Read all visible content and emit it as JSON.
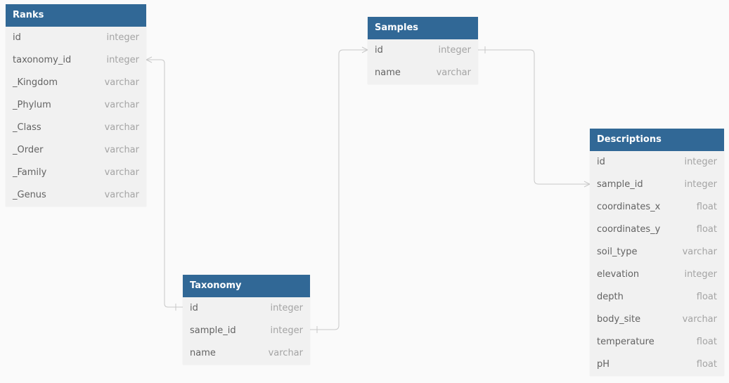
{
  "tables": {
    "ranks": {
      "title": "Ranks",
      "columns": [
        {
          "name": "id",
          "type": "integer"
        },
        {
          "name": "taxonomy_id",
          "type": "integer"
        },
        {
          "name": "_Kingdom",
          "type": "varchar"
        },
        {
          "name": "_Phylum",
          "type": "varchar"
        },
        {
          "name": "_Class",
          "type": "varchar"
        },
        {
          "name": "_Order",
          "type": "varchar"
        },
        {
          "name": "_Family",
          "type": "varchar"
        },
        {
          "name": "_Genus",
          "type": "varchar"
        }
      ]
    },
    "samples": {
      "title": "Samples",
      "columns": [
        {
          "name": "id",
          "type": "integer"
        },
        {
          "name": "name",
          "type": "varchar"
        }
      ]
    },
    "taxonomy": {
      "title": "Taxonomy",
      "columns": [
        {
          "name": "id",
          "type": "integer"
        },
        {
          "name": "sample_id",
          "type": "integer"
        },
        {
          "name": "name",
          "type": "varchar"
        }
      ]
    },
    "descriptions": {
      "title": "Descriptions",
      "columns": [
        {
          "name": "id",
          "type": "integer"
        },
        {
          "name": "sample_id",
          "type": "integer"
        },
        {
          "name": "coordinates_x",
          "type": "float"
        },
        {
          "name": "coordinates_y",
          "type": "float"
        },
        {
          "name": "soil_type",
          "type": "varchar"
        },
        {
          "name": "elevation",
          "type": "integer"
        },
        {
          "name": "depth",
          "type": "float"
        },
        {
          "name": "body_site",
          "type": "varchar"
        },
        {
          "name": "temperature",
          "type": "float"
        },
        {
          "name": "pH",
          "type": "float"
        }
      ]
    }
  },
  "relationships": [
    {
      "from": "ranks.taxonomy_id",
      "to": "taxonomy.id",
      "from_cardinality": "many",
      "to_cardinality": "one"
    },
    {
      "from": "taxonomy.sample_id",
      "to": "samples.id",
      "from_cardinality": "one",
      "to_cardinality": "many"
    },
    {
      "from": "descriptions.sample_id",
      "to": "samples.id",
      "from_cardinality": "many",
      "to_cardinality": "one"
    }
  ],
  "colors": {
    "background": "#fafafa",
    "header": "#316896",
    "header_text": "#ffffff",
    "body": "#f1f1f1",
    "column_name": "#636363",
    "column_type": "#a4a4a4",
    "connector": "#c8c8c8"
  }
}
